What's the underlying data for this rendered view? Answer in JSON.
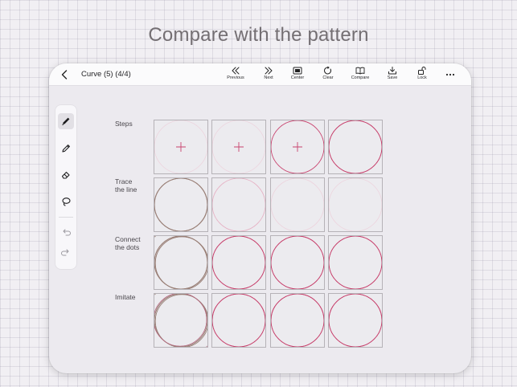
{
  "headline": "Compare with the pattern",
  "toolbar": {
    "title": "Curve (5) (4/4)",
    "previous": "Previous",
    "next": "Next",
    "center": "Center",
    "clear": "Clear",
    "compare": "Compare",
    "save": "Save",
    "lock": "Lock"
  },
  "tools": [
    "pen-icon",
    "pencil-icon",
    "eraser-icon",
    "lasso-icon",
    "undo-icon",
    "redo-icon"
  ],
  "rows": [
    {
      "label1": "Steps",
      "label2": ""
    },
    {
      "label1": "Trace",
      "label2": "the line"
    },
    {
      "label1": "Connect",
      "label2": "the dots"
    },
    {
      "label1": "Imitate",
      "label2": ""
    }
  ],
  "colors": {
    "accent": "#c8436e",
    "faint": "#e6b4c6",
    "light": "#edd3dd",
    "brown": "#9a8078",
    "background": "#f1eff3",
    "panel": "#eceaef"
  }
}
